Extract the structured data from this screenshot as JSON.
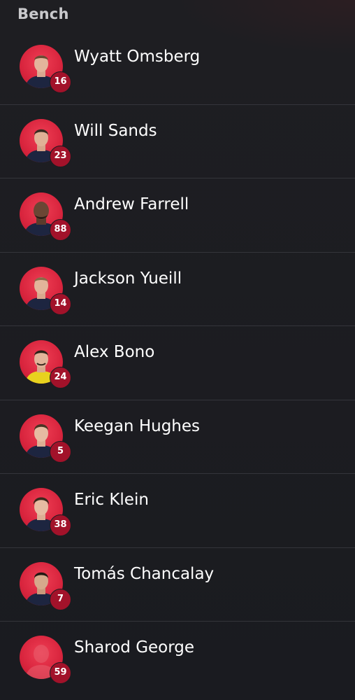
{
  "section": {
    "title": "Bench"
  },
  "colors": {
    "background": "#1b1c21",
    "avatar_bg": "#d8243d",
    "number_badge": "#a2122a",
    "divider": "#34353b"
  },
  "players": [
    {
      "name": "Wyatt Omsberg",
      "number": "16",
      "kit": "navy-shirt",
      "photo": "player-photo"
    },
    {
      "name": "Will Sands",
      "number": "23",
      "kit": "navy-shirt",
      "photo": "player-photo"
    },
    {
      "name": "Andrew Farrell",
      "number": "88",
      "kit": "navy-shirt",
      "photo": "player-photo"
    },
    {
      "name": "Jackson Yueill",
      "number": "14",
      "kit": "navy-shirt",
      "photo": "player-photo"
    },
    {
      "name": "Alex Bono",
      "number": "24",
      "kit": "goalkeeper-yellow-shirt",
      "photo": "player-photo"
    },
    {
      "name": "Keegan Hughes",
      "number": "5",
      "kit": "navy-shirt",
      "photo": "player-photo"
    },
    {
      "name": "Eric Klein",
      "number": "38",
      "kit": "navy-shirt",
      "photo": "player-photo"
    },
    {
      "name": "Tomás Chancalay",
      "number": "7",
      "kit": "navy-shirt",
      "photo": "player-photo"
    },
    {
      "name": "Sharod George",
      "number": "59",
      "kit": "none",
      "photo": "placeholder-silhouette"
    }
  ]
}
